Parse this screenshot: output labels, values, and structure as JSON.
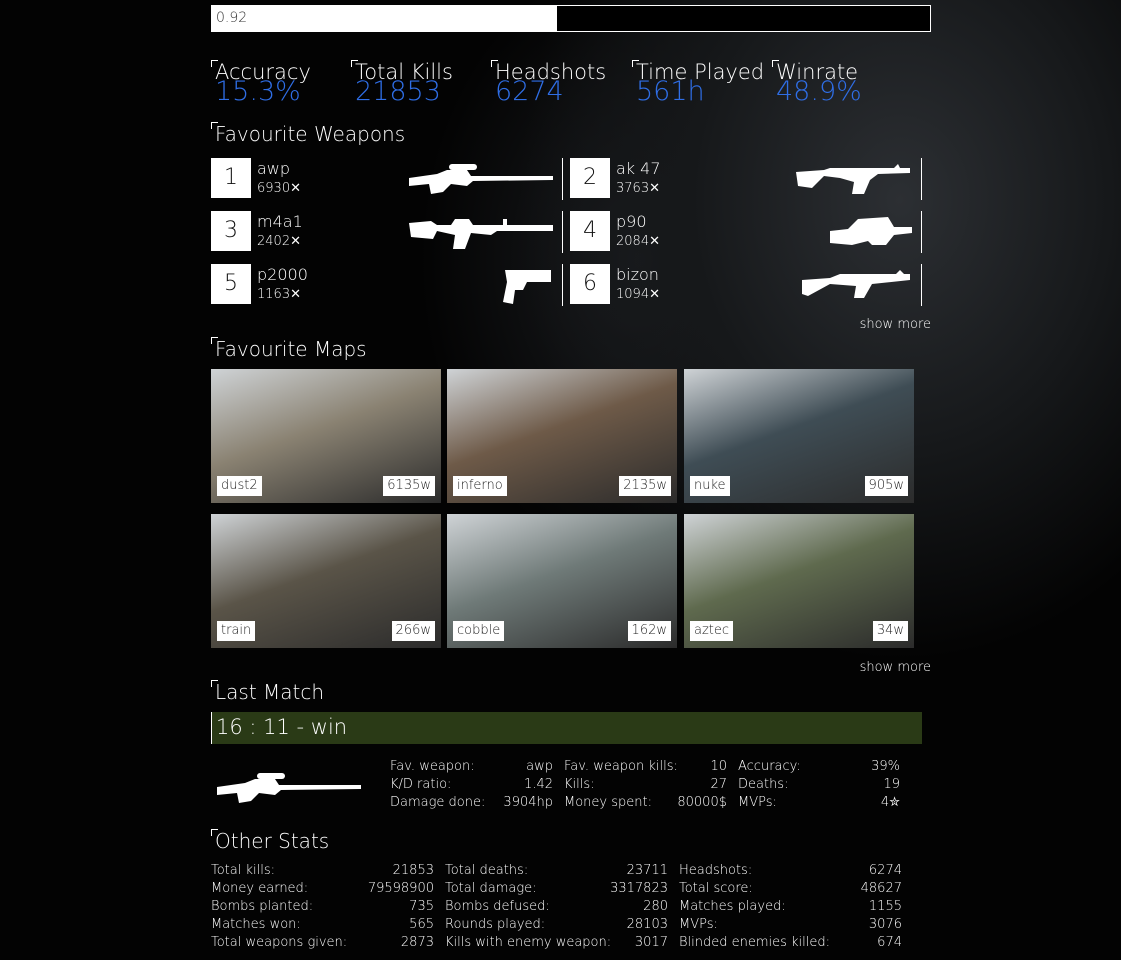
{
  "progress": {
    "label": "0.92",
    "fraction": 0.48
  },
  "summary": [
    {
      "label": "Accuracy",
      "value": "15.3%"
    },
    {
      "label": "Total Kills",
      "value": "21853"
    },
    {
      "label": "Headshots",
      "value": "6274"
    },
    {
      "label": "Time Played",
      "value": "561h"
    },
    {
      "label": "Winrate",
      "value": "48.9%"
    }
  ],
  "weapons_title": "Favourite Weapons",
  "weapons": [
    {
      "rank": "1",
      "name": "awp",
      "kills": "6930✕",
      "icon": "sniper-rifle-icon"
    },
    {
      "rank": "2",
      "name": "ak 47",
      "kills": "3763✕",
      "icon": "assault-rifle-icon"
    },
    {
      "rank": "3",
      "name": "m4a1",
      "kills": "2402✕",
      "icon": "carbine-icon"
    },
    {
      "rank": "4",
      "name": "p90",
      "kills": "2084✕",
      "icon": "smg-icon"
    },
    {
      "rank": "5",
      "name": "p2000",
      "kills": "1163✕",
      "icon": "pistol-icon"
    },
    {
      "rank": "6",
      "name": "bizon",
      "kills": "1094✕",
      "icon": "smg-icon"
    }
  ],
  "show_more": "show more",
  "maps_title": "Favourite Maps",
  "maps": [
    {
      "name": "dust2",
      "wins": "6135w",
      "color": "#8a8272"
    },
    {
      "name": "inferno",
      "wins": "2135w",
      "color": "#6e5a48"
    },
    {
      "name": "nuke",
      "wins": "905w",
      "color": "#3f4d55"
    },
    {
      "name": "train",
      "wins": "266w",
      "color": "#5a5448"
    },
    {
      "name": "cobble",
      "wins": "162w",
      "color": "#6f7a78"
    },
    {
      "name": "aztec",
      "wins": "34w",
      "color": "#5f6a4e"
    }
  ],
  "last_match_title": "Last Match",
  "last_match": {
    "result": "16 : 11 - win",
    "stats": [
      [
        {
          "label": "Fav. weapon:",
          "value": "awp"
        },
        {
          "label": "Fav. weapon kills:",
          "value": "10"
        },
        {
          "label": "Accuracy:",
          "value": "39%"
        }
      ],
      [
        {
          "label": "K/D ratio:",
          "value": "1.42"
        },
        {
          "label": "Kills:",
          "value": "27"
        },
        {
          "label": "Deaths:",
          "value": "19"
        }
      ],
      [
        {
          "label": "Damage done:",
          "value": "3904hp"
        },
        {
          "label": "Money spent:",
          "value": "80000$"
        },
        {
          "label": "MVPs:",
          "value": "4✮"
        }
      ]
    ]
  },
  "other_title": "Other Stats",
  "other_stats": [
    [
      {
        "label": "Total kills:",
        "value": "21853"
      },
      {
        "label": "Total deaths:",
        "value": "23711"
      },
      {
        "label": "Headshots:",
        "value": "6274"
      }
    ],
    [
      {
        "label": "Money earned:",
        "value": "79598900"
      },
      {
        "label": "Total damage:",
        "value": "3317823"
      },
      {
        "label": "Total score:",
        "value": "48627"
      }
    ],
    [
      {
        "label": "Bombs planted:",
        "value": "735"
      },
      {
        "label": "Bombs defused:",
        "value": "280"
      },
      {
        "label": "Matches played:",
        "value": "1155"
      }
    ],
    [
      {
        "label": "Matches won:",
        "value": "565"
      },
      {
        "label": "Rounds played:",
        "value": "28103"
      },
      {
        "label": "MVPs:",
        "value": "3076"
      }
    ],
    [
      {
        "label": "Total weapons given:",
        "value": "2873"
      },
      {
        "label": "Kills with enemy weapon:",
        "value": "3017"
      },
      {
        "label": "Blinded enemies killed:",
        "value": "674"
      }
    ]
  ]
}
